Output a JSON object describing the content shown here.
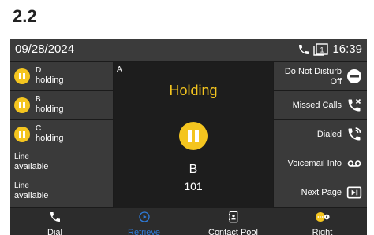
{
  "heading": "2.2",
  "status_bar": {
    "date": "09/28/2024",
    "time": "16:39",
    "account_number": "1"
  },
  "lines": [
    {
      "name": "D",
      "state": "holding",
      "icon": "pause-icon"
    },
    {
      "name": "B",
      "state": "holding",
      "icon": "pause-icon"
    },
    {
      "name": "C",
      "state": "holding",
      "icon": "pause-icon"
    },
    {
      "name": "Line",
      "state": "available"
    },
    {
      "name": "Line",
      "state": "available"
    }
  ],
  "call": {
    "line_label": "A",
    "status": "Holding",
    "contact_name": "B",
    "contact_number": "101"
  },
  "keys": [
    {
      "label": "Do Not Disturb",
      "value": "Off",
      "icon": "dnd-icon"
    },
    {
      "label": "Missed Calls",
      "icon": "missed-calls-icon"
    },
    {
      "label": "Dialed",
      "icon": "dialed-icon"
    },
    {
      "label": "Voicemail Info",
      "icon": "voicemail-icon"
    },
    {
      "label": "Next Page",
      "icon": "next-page-icon"
    }
  ],
  "softkeys": [
    {
      "label": "Dial",
      "icon": "phone-icon"
    },
    {
      "label": "Retrieve",
      "icon": "play-circle-icon",
      "active": true
    },
    {
      "label": "Contact Pool",
      "icon": "contacts-icon"
    },
    {
      "label": "Right",
      "icon": "more-icon"
    }
  ],
  "colors": {
    "accent": "#f4c51f",
    "active": "#2f7bd9",
    "panel": "#3a3a3a",
    "background": "#1b1b1b"
  }
}
